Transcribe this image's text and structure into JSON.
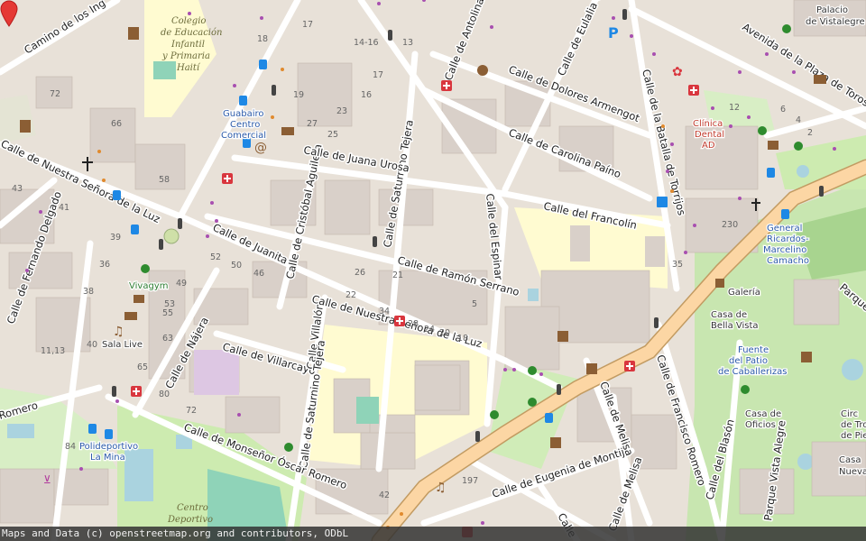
{
  "map": {
    "attribution": "Maps and Data (c) openstreetmap.org and contributors, ODbL"
  },
  "streets": {
    "camino_ingenieros": "Camino de los Ing",
    "nuestra_senora_luz_w": "Calle de Nuestra Señora de la Luz",
    "nuestra_senora_luz_s": "Calle de Nuestra Señora de la Luz",
    "fernando_delgado": "Calle de Fernando Delgado",
    "juanita": "Calle de Juanita",
    "cristobal_aguilera": "Calle de Cristóbal Aguilera",
    "saturnino_tejera_n": "Calle de Saturnino Tejera",
    "saturnino_tejera_s": "Calle de Saturnino Tejera",
    "juana_urosa": "Calle de Juana Urosa",
    "ramon_serrano": "Calle de Ramón Serrano",
    "espinar": "Calle del Espinar",
    "antolina": "Calle de Antolina M",
    "eulalia_gil": "Calle de Eulalia Gil",
    "dolores_armengot": "Calle de Dolores Armengot",
    "carolina_paino": "Calle de Carolina Paíno",
    "batalla_torrijos": "Calle de la Batalla de Torrijos",
    "francolin": "Calle del Francolín",
    "plaza_toros": "Avenida de la Plaza de Toros",
    "najera": "Calle de Nájera",
    "villarcayo": "Calle de Villarcayo",
    "villalon": "Calle Villalón",
    "oscar_romero": "Calle de Monseñor Óscar Romero",
    "romero_w": "Romero",
    "eugenia_montijo": "Calle de Eugenia de Montijo",
    "melisa_1": "Calle de Melisa",
    "melisa_2": "Calle de Melisa",
    "francisco_romero": "Calle de Francisco Romero",
    "blason": "Calle del Blasón",
    "parque_vista_alegre": "Parque Vista Alegre",
    "calle_s": "Calle",
    "parque_e": "Parque",
    "calle_num": "Calle"
  },
  "pois": {
    "colegio": "Colegio de Educación Infantil y Primaria Haití",
    "guabairo": "Guabairo Centro Comercial",
    "clinica_dental": "Clínica Dental AD",
    "general_ricardos": "General Ricardos-Marcelino Camacho",
    "galeria": "Galería",
    "casa_bella_vista": "Casa de Bella Vista",
    "fuente_patio": "Fuente del Patio de Caballerizas",
    "casa_oficios": "Casa de Oficios",
    "circ": "Circ de Tro de Pie",
    "palacio": "Palacio de Vistalegre",
    "vivagym": "Vivagym",
    "sala_live": "Sala Live",
    "polideportivo": "Polideportivo La Mina",
    "centro_deportivo": "Centro Deportivo",
    "casa_nueva": "Casa Nueva"
  },
  "house_numbers": [
    "72",
    "66",
    "58",
    "43",
    "41",
    "39",
    "36",
    "38",
    "40",
    "11,13",
    "84",
    "80",
    "72",
    "65",
    "63",
    "55",
    "53",
    "49",
    "52",
    "50",
    "46",
    "22",
    "21",
    "24",
    "20",
    "18",
    "34",
    "28",
    "26",
    "18",
    "13",
    "14-16",
    "17",
    "16",
    "23",
    "25",
    "27",
    "19",
    "18",
    "22",
    "17",
    "230",
    "35",
    "12",
    "6",
    "4",
    "2",
    "197",
    "42",
    "5",
    "7",
    "9"
  ],
  "icons": {
    "hospital_color": "#d9363e",
    "bus_color": "#1e88e5",
    "marker_color": "#e53935",
    "primary_road_color": "#fcd6a4",
    "park_color": "#cdebb0",
    "school_color": "#fffbd1"
  }
}
